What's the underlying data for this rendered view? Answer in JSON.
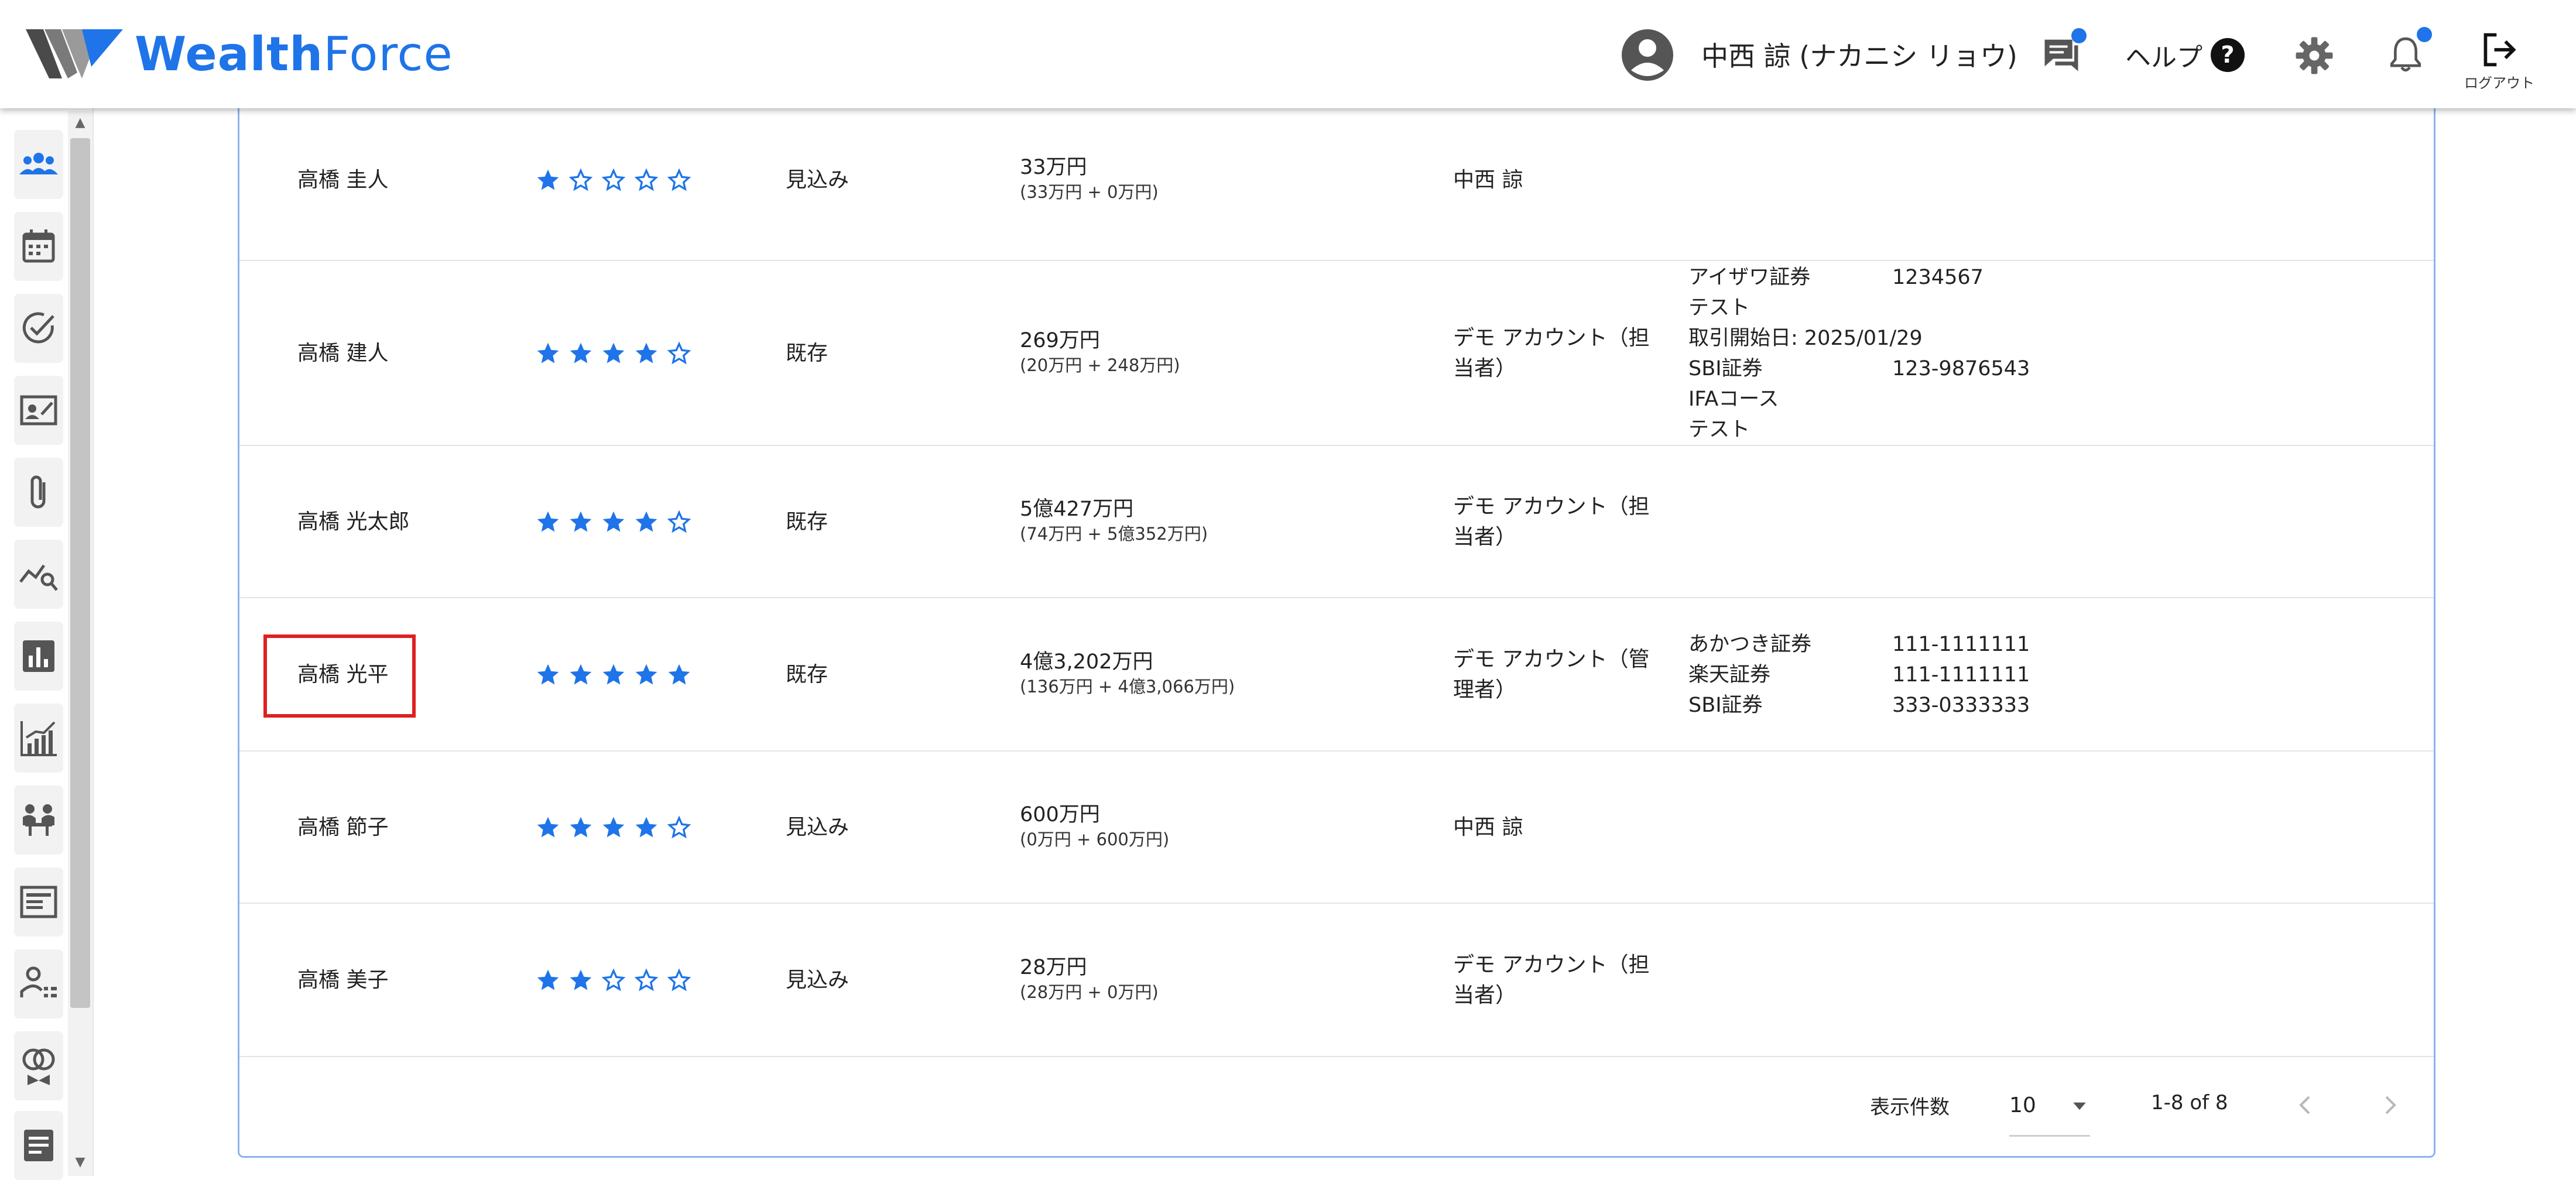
{
  "header": {
    "logo_wealth": "Wealth",
    "logo_force": "Force",
    "user_name": "中西 諒 (ナカニシ リョウ)",
    "help_label": "ヘルプ",
    "help_icon": "?",
    "logout_label": "ログアウト"
  },
  "colors": {
    "accent": "#1e74e8",
    "highlight": "#e02020",
    "card_border": "#8fb2ee"
  },
  "sidebar": {
    "items": [
      "people-icon",
      "calendar-icon",
      "check-circle-icon",
      "contact-card-icon",
      "paperclip-icon",
      "chart-search-icon",
      "bar-chart-icon",
      "growth-chart-icon",
      "meeting-icon",
      "news-icon",
      "person-list-icon",
      "rings-icon",
      "document-icon"
    ]
  },
  "table": {
    "rows": [
      {
        "name": "高橋 圭人",
        "rating": 1,
        "status": "見込み",
        "amount": "33万円",
        "amount_detail": "(33万円 + 0万円)",
        "manager": "中西 諒",
        "accounts": []
      },
      {
        "name": "高橋 建人",
        "rating": 4,
        "status": "既存",
        "amount": "269万円",
        "amount_detail": "(20万円 + 248万円)",
        "manager": "デモ アカウント（担当者）",
        "accounts": [
          {
            "label": "アイザワ証券",
            "value": "1234567"
          },
          {
            "label": "テスト",
            "value": ""
          },
          {
            "label": "取引開始日: 2025/01/29",
            "value": ""
          },
          {
            "label": "SBI証券",
            "value": "123-9876543"
          },
          {
            "label": "IFAコース",
            "value": ""
          },
          {
            "label": "テスト",
            "value": ""
          }
        ]
      },
      {
        "name": "高橋 光太郎",
        "rating": 4,
        "status": "既存",
        "amount": "5億427万円",
        "amount_detail": "(74万円 + 5億352万円)",
        "manager": "デモ アカウント（担当者）",
        "accounts": []
      },
      {
        "name": "高橋 光平",
        "rating": 5,
        "status": "既存",
        "amount": "4億3,202万円",
        "amount_detail": "(136万円 + 4億3,066万円)",
        "manager": "デモ アカウント（管理者）",
        "accounts": [
          {
            "label": "あかつき証券",
            "value": "111-1111111"
          },
          {
            "label": "楽天証券",
            "value": "111-1111111"
          },
          {
            "label": "SBI証券",
            "value": "333-0333333"
          }
        ]
      },
      {
        "name": "高橋 節子",
        "rating": 4,
        "status": "見込み",
        "amount": "600万円",
        "amount_detail": "(0万円 + 600万円)",
        "manager": "中西 諒",
        "accounts": []
      },
      {
        "name": "高橋 美子",
        "rating": 2,
        "status": "見込み",
        "amount": "28万円",
        "amount_detail": "(28万円 + 0万円)",
        "manager": "デモ アカウント（担当者）",
        "accounts": []
      }
    ]
  },
  "pagination": {
    "rows_per_page_label": "表示件数",
    "rows_per_page": "10",
    "range": "1-8 of 8"
  }
}
